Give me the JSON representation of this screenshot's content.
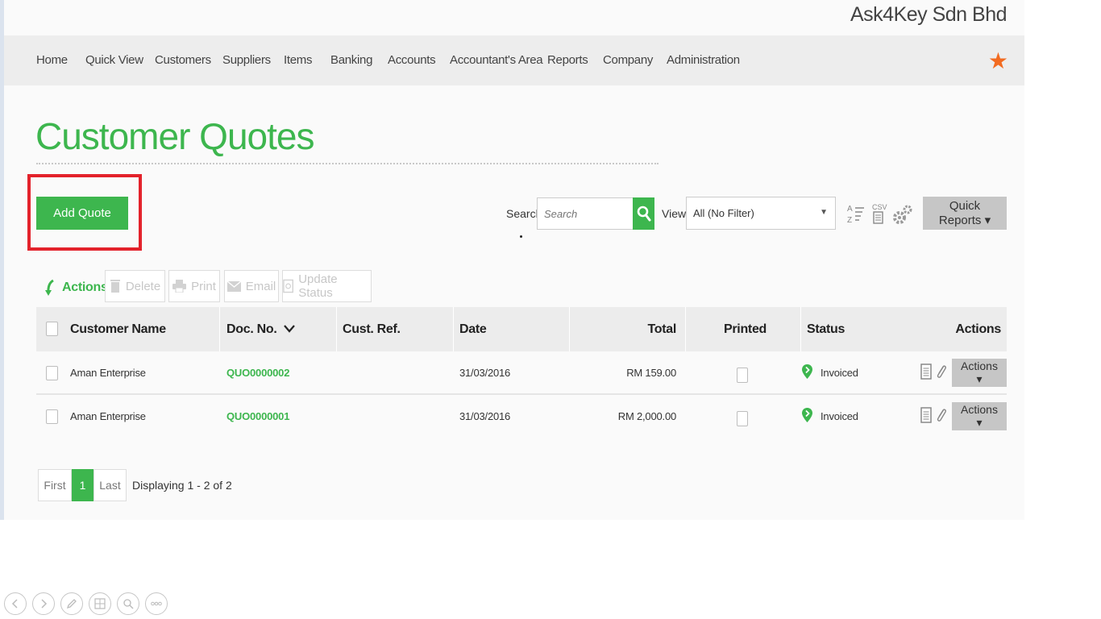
{
  "company": "Ask4Key Sdn Bhd",
  "nav": [
    "Home",
    "Quick View",
    "Customers",
    "Suppliers",
    "Items",
    "Banking",
    "Accounts",
    "Accountant's Area",
    "Reports",
    "Company",
    "Administration"
  ],
  "page_title": "Customer Quotes",
  "add_button": "Add Quote",
  "search": {
    "label": "Search:",
    "placeholder": "Search"
  },
  "view": {
    "label": "View:",
    "selected": "All (No Filter)"
  },
  "quick_reports": "Quick Reports ▾",
  "csv_label": "CSV",
  "actions_bar": {
    "label": "Actions",
    "delete": "Delete",
    "print": "Print",
    "email": "Email",
    "update_status": "Update Status"
  },
  "table": {
    "headers": {
      "customer": "Customer Name",
      "doc": "Doc. No.",
      "ref": "Cust. Ref.",
      "date": "Date",
      "total": "Total",
      "printed": "Printed",
      "status": "Status",
      "actions": "Actions"
    },
    "rows": [
      {
        "customer": "Aman Enterprise",
        "doc": "QUO0000002",
        "ref": "",
        "date": "31/03/2016",
        "total": "RM 159.00",
        "status": "Invoiced",
        "action": "Actions ▾"
      },
      {
        "customer": "Aman Enterprise",
        "doc": "QUO0000001",
        "ref": "",
        "date": "31/03/2016",
        "total": "RM 2,000.00",
        "status": "Invoiced",
        "action": "Actions ▾"
      }
    ]
  },
  "pager": {
    "first": "First",
    "page": "1",
    "last": "Last",
    "info": "Displaying 1 - 2 of 2"
  },
  "colors": {
    "accent": "#3db64e",
    "star": "#f26b21",
    "highlight": "#e3222b"
  }
}
